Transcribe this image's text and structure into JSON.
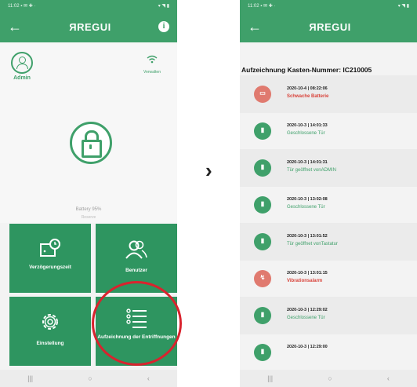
{
  "left_screen": {
    "status_time": "11:02 ▪ ✉ ✚ ·",
    "status_right": "▾ ◥ ▮",
    "back_icon": "←",
    "brand": "ЯREGUI",
    "info_icon": "i",
    "admin_label": "Admin",
    "wifi_label": "Verwalten",
    "battery_text": "Battery 95%",
    "battery_sub": "Reserve",
    "tiles": {
      "delay": "Verzögerungszeit",
      "users": "Benutzer",
      "settings": "Einstellung",
      "log": "Aufzeichnung der Entriffnungen"
    },
    "nav": [
      "|||",
      "○",
      "‹"
    ]
  },
  "chevron": "›",
  "right_screen": {
    "status_time": "11:02 ▪ ✉ ✚ ·",
    "status_right": "▾ ◥ ▮",
    "back_icon": "←",
    "brand": "ЯREGUI",
    "title": "Aufzeichnung Kasten-Nummer: IC210005",
    "entries": [
      {
        "time": "2020-10-4 | 08:22:06",
        "text": "Schwache Batterie",
        "color": "red",
        "icon": "battery"
      },
      {
        "time": "2020-10-3 | 14:01:33",
        "text": "Geschlossene Tür",
        "color": "green",
        "icon": "lock"
      },
      {
        "time": "2020-10-3 | 14:01:31",
        "text": "Tür geöffnet vonADMIN",
        "color": "green",
        "icon": "lock"
      },
      {
        "time": "2020-10-3 | 13:02:08",
        "text": "Geschlossene Tür",
        "color": "green",
        "icon": "lock"
      },
      {
        "time": "2020-10-3 | 13:01:52",
        "text": "Tür geöffnet vonTastatur",
        "color": "green",
        "icon": "lock"
      },
      {
        "time": "2020-10-3 | 13:01:15",
        "text": "Vibrationsalarm",
        "color": "red",
        "icon": "alarm"
      },
      {
        "time": "2020-10-3 | 12:29:02",
        "text": "Geschlossene Tür",
        "color": "green",
        "icon": "lock"
      },
      {
        "time": "2020-10-3 | 12:29:00",
        "text": "",
        "color": "green",
        "icon": "lock"
      }
    ],
    "nav": [
      "|||",
      "○",
      "‹"
    ]
  }
}
